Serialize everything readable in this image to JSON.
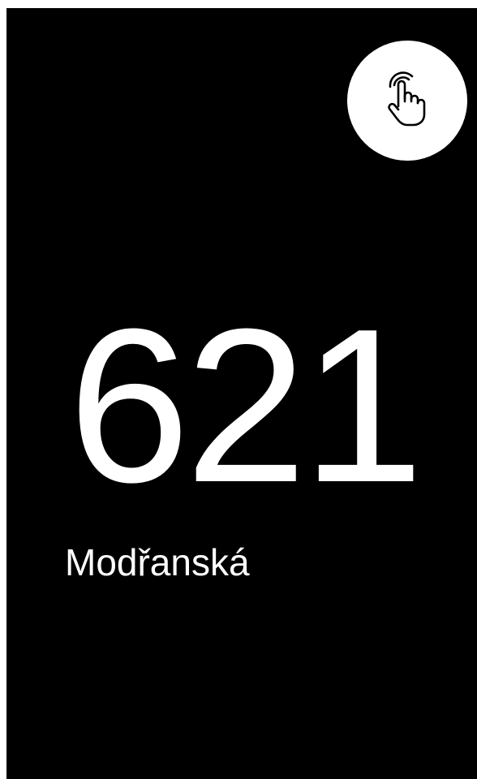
{
  "screen": {
    "background": "#000000",
    "tap_button": {
      "icon": "touch-hand-icon",
      "background": "#ffffff"
    },
    "stop_number": "621",
    "stop_name": "Modřanská"
  }
}
